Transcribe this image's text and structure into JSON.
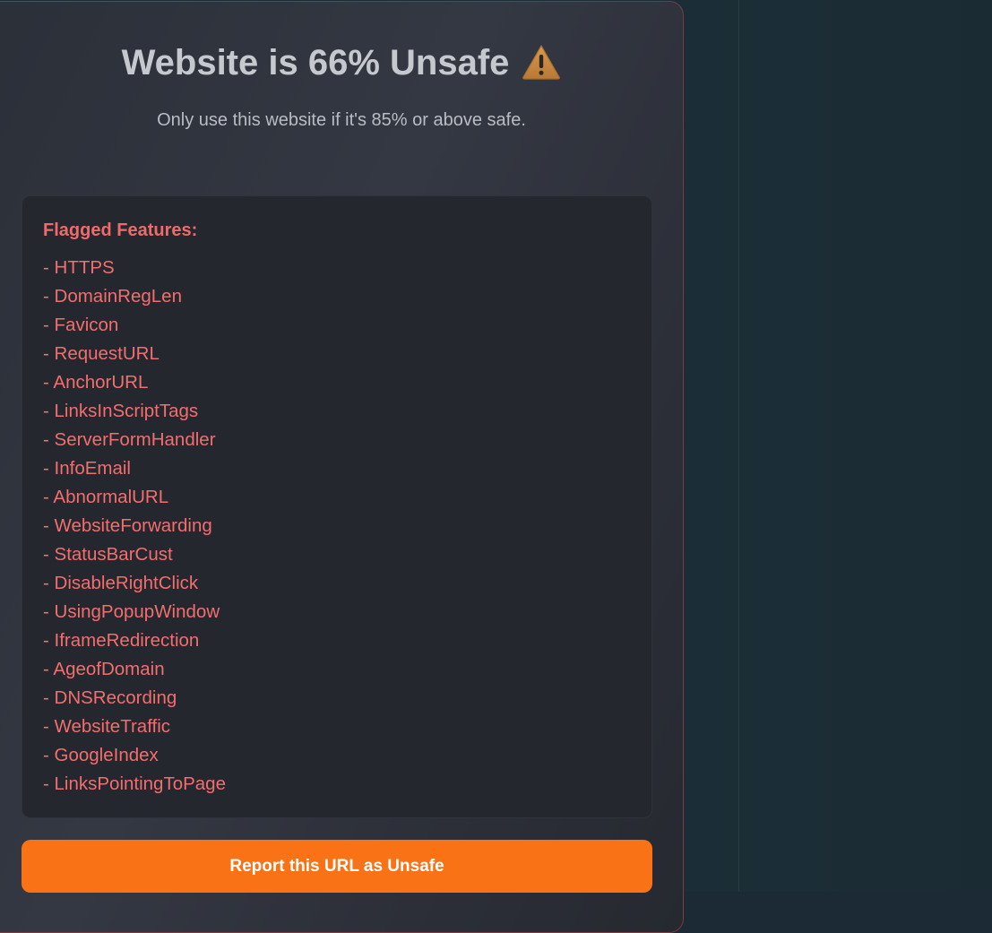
{
  "result": {
    "title": "Website is 66% Unsafe",
    "warning_icon": "warning-icon",
    "subtitle": "Only use this website if it's 85% or above safe."
  },
  "flagged": {
    "heading": "Flagged Features:",
    "items": [
      "- HTTPS",
      "- DomainRegLen",
      "- Favicon",
      "- RequestURL",
      "- AnchorURL",
      "- LinksInScriptTags",
      "- ServerFormHandler",
      "- InfoEmail",
      "- AbnormalURL",
      "- WebsiteForwarding",
      "- StatusBarCust",
      "- DisableRightClick",
      "- UsingPopupWindow",
      "- IframeRedirection",
      "- AgeofDomain",
      "- DNSRecording",
      "- WebsiteTraffic",
      "- GoogleIndex",
      "- LinksPointingToPage"
    ]
  },
  "actions": {
    "report_label": "Report this URL as Unsafe"
  },
  "colors": {
    "accent": "#f97316",
    "flag_text": "#f06f6f",
    "warning": "#c98a3e"
  }
}
